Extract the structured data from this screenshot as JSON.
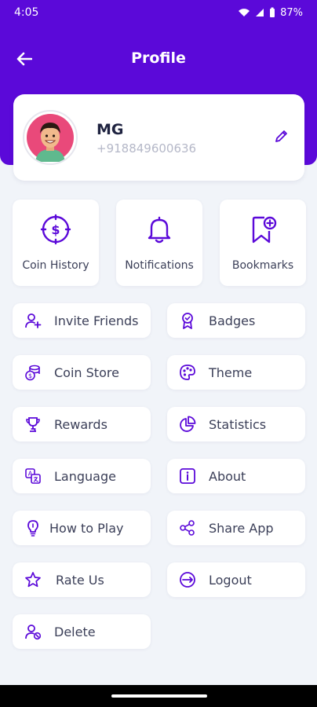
{
  "status_bar": {
    "time": "4:05",
    "battery": "87%"
  },
  "app_bar": {
    "title": "Profile"
  },
  "profile": {
    "name": "MG",
    "phone": "+918849600636"
  },
  "tiles": [
    {
      "label": "Coin History",
      "icon": "coin-history-icon"
    },
    {
      "label": "Notifications",
      "icon": "bell-icon"
    },
    {
      "label": "Bookmarks",
      "icon": "bookmark-add-icon"
    }
  ],
  "menu": [
    {
      "label": "Invite Friends",
      "icon": "invite-user-icon"
    },
    {
      "label": "Badges",
      "icon": "badge-icon"
    },
    {
      "label": "Coin Store",
      "icon": "coin-stack-icon"
    },
    {
      "label": "Theme",
      "icon": "palette-icon"
    },
    {
      "label": "Rewards",
      "icon": "trophy-icon"
    },
    {
      "label": "Statistics",
      "icon": "pie-chart-icon"
    },
    {
      "label": "Language",
      "icon": "translate-icon"
    },
    {
      "label": "About",
      "icon": "info-icon"
    },
    {
      "label": "How to Play",
      "icon": "lightbulb-icon"
    },
    {
      "label": "Share App",
      "icon": "share-icon"
    },
    {
      "label": "Rate Us",
      "icon": "star-icon"
    },
    {
      "label": "Logout",
      "icon": "logout-icon"
    },
    {
      "label": "Delete",
      "icon": "delete-user-icon"
    }
  ],
  "colors": {
    "primary": "#5b09d9",
    "background": "#f1f4f9",
    "card": "#ffffff",
    "text": "#3b3f58"
  }
}
